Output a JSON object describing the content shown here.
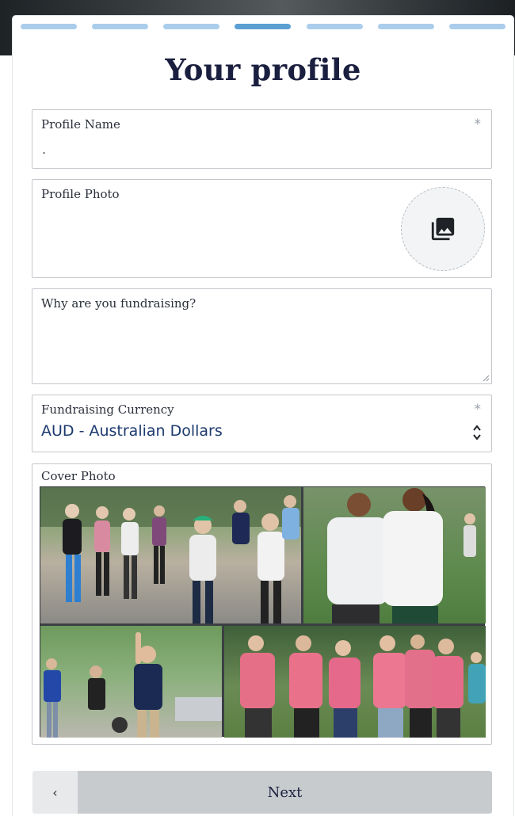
{
  "progress": {
    "total_steps": 7,
    "current_step": 4
  },
  "page": {
    "title": "Your profile"
  },
  "fields": {
    "profile_name": {
      "label": "Profile Name",
      "required_mark": "*",
      "value": "."
    },
    "profile_photo": {
      "label": "Profile Photo",
      "icon": "photo-library-icon"
    },
    "why": {
      "label": "Why are you fundraising?",
      "value": ""
    },
    "currency": {
      "label": "Fundraising Currency",
      "required_mark": "*",
      "selected": "AUD - Australian Dollars"
    },
    "cover_photo": {
      "label": "Cover Photo"
    }
  },
  "nav": {
    "back_label": "‹",
    "next_label": "Next"
  },
  "colors": {
    "progress_done": "#aacdeb",
    "progress_active": "#5b9fd3",
    "title": "#1b1f3f",
    "currency_text": "#1c3a6e",
    "next_button_bg": "#c8cbce",
    "back_button_bg": "#e8e9ea"
  }
}
